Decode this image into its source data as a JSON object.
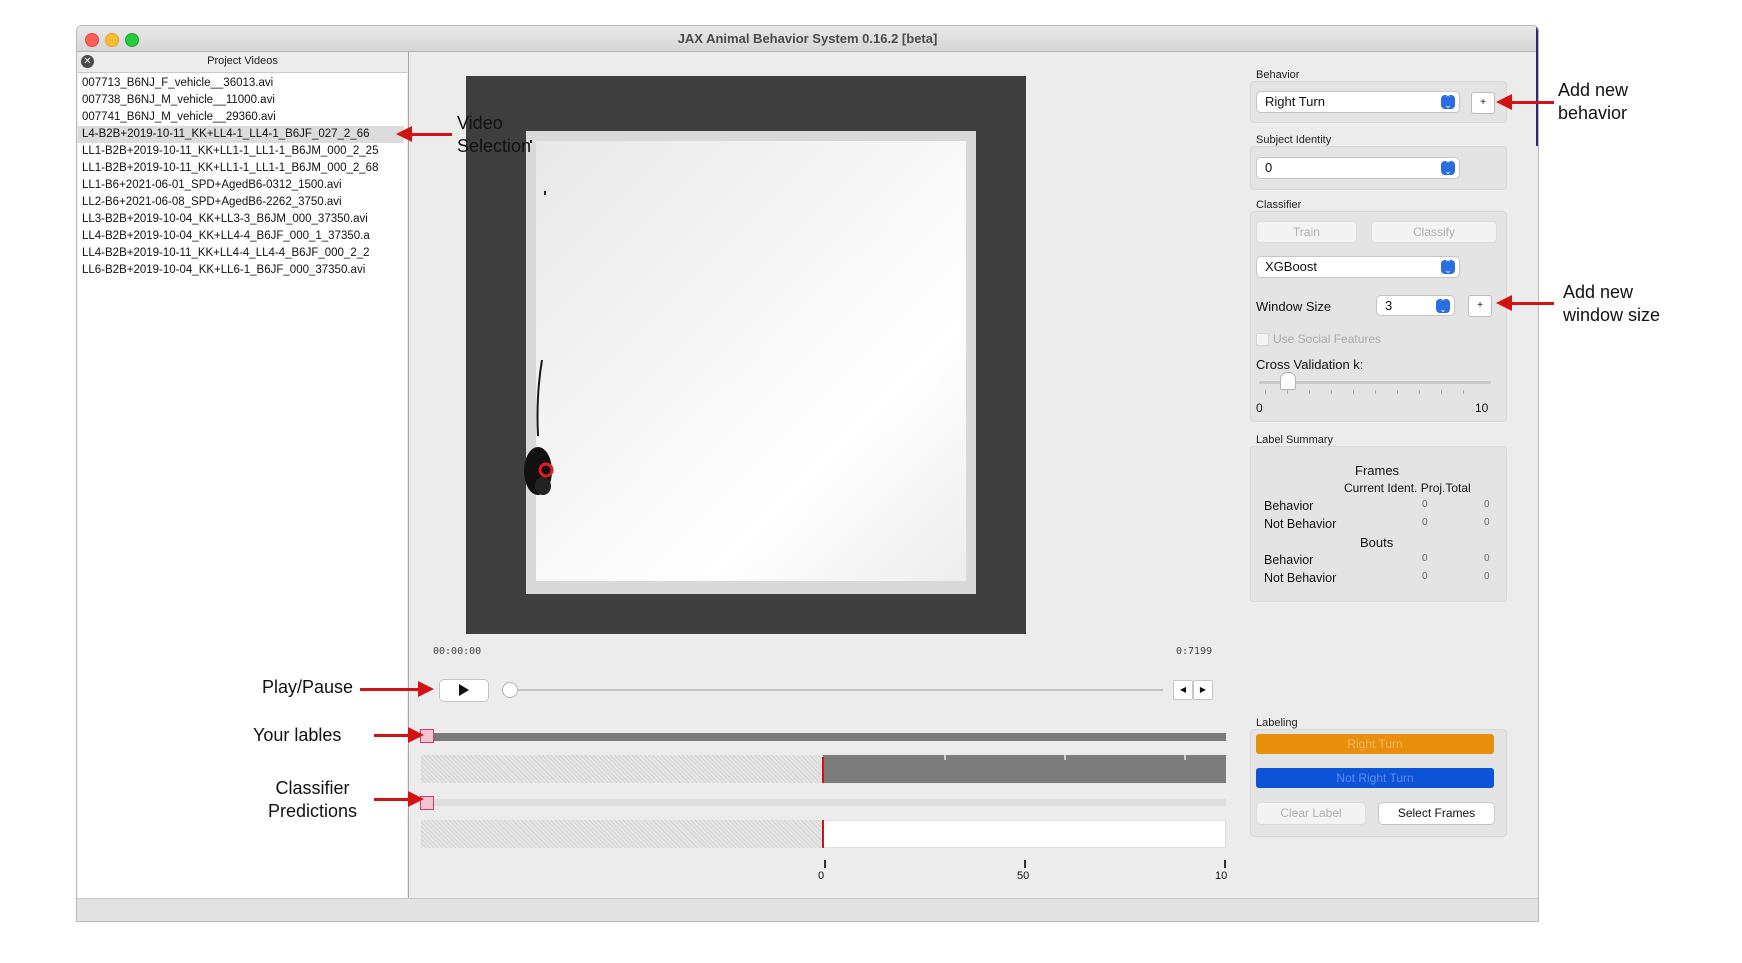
{
  "window": {
    "title": "JAX Animal Behavior System 0.16.2 [beta]"
  },
  "project_videos": {
    "title": "Project Videos",
    "items": [
      "007713_B6NJ_F_vehicle__36013.avi",
      "007738_B6NJ_M_vehicle__11000.avi",
      "007741_B6NJ_M_vehicle__29360.avi",
      "L4-B2B+2019-10-11_KK+LL4-1_LL4-1_B6JF_027_2_66",
      "LL1-B2B+2019-10-11_KK+LL1-1_LL1-1_B6JM_000_2_25",
      "LL1-B2B+2019-10-11_KK+LL1-1_LL1-1_B6JM_000_2_68",
      "LL1-B6+2021-06-01_SPD+AgedB6-0312_1500.avi",
      "LL2-B6+2021-06-08_SPD+AgedB6-2262_3750.avi",
      "LL3-B2B+2019-10-04_KK+LL3-3_B6JM_000_37350.avi",
      "LL4-B2B+2019-10-04_KK+LL4-4_B6JF_000_1_37350.a",
      "LL4-B2B+2019-10-11_KK+LL4-4_LL4-4_B6JF_000_2_2",
      "LL6-B2B+2019-10-04_KK+LL6-1_B6JF_000_37350.avi"
    ],
    "selected_index": 3
  },
  "player": {
    "time_start": "00:00:00",
    "time_end": "0:7199",
    "play_icon": "play-icon",
    "prev_icon": "step-back-icon",
    "next_icon": "step-forward-icon",
    "position": 0
  },
  "timeline": {
    "axis_ticks": [
      "0",
      "50",
      "10"
    ],
    "colors": {
      "label_track": "#7a7a7a",
      "cursor": "#d21313"
    }
  },
  "behavior": {
    "label": "Behavior",
    "selected": "Right Turn",
    "add_button": "+"
  },
  "subject": {
    "label": "Subject Identity",
    "selected": "0"
  },
  "classifier": {
    "label": "Classifier",
    "train": "Train",
    "classify": "Classify",
    "algorithm": "XGBoost",
    "window_size_label": "Window Size",
    "window_size": "3",
    "add_window_button": "+",
    "social_features": "Use Social Features",
    "cv_label": "Cross Validation k:",
    "cv_min": "0",
    "cv_max": "10",
    "cv_value_fraction": 0.12
  },
  "label_summary": {
    "title": "Label Summary",
    "frames_header": "Frames",
    "columns_header": "Current Ident. Proj.Total",
    "bouts_header": "Bouts",
    "frames_rows": [
      {
        "name": "Behavior",
        "current": "0",
        "total": "0"
      },
      {
        "name": "Not Behavior",
        "current": "0",
        "total": "0"
      }
    ],
    "bouts_rows": [
      {
        "name": "Behavior",
        "current": "0",
        "total": "0"
      },
      {
        "name": "Not Behavior",
        "current": "0",
        "total": "0"
      }
    ]
  },
  "labeling": {
    "title": "Labeling",
    "behavior_button": "Right Turn",
    "not_behavior_button": "Not Right Turn",
    "clear_label": "Clear Label",
    "select_frames": "Select Frames",
    "colors": {
      "behavior": "#e8900e",
      "not_behavior": "#0d53d8"
    }
  },
  "annotations": {
    "add_behavior": [
      "Add new",
      "behavior"
    ],
    "video_selection": [
      "Video",
      "Selection"
    ],
    "add_window": [
      "Add new",
      "window size"
    ],
    "play_pause": "Play/Pause",
    "your_labels": "Your lables",
    "classifier_predictions": [
      "Classifier",
      "Predictions"
    ]
  }
}
